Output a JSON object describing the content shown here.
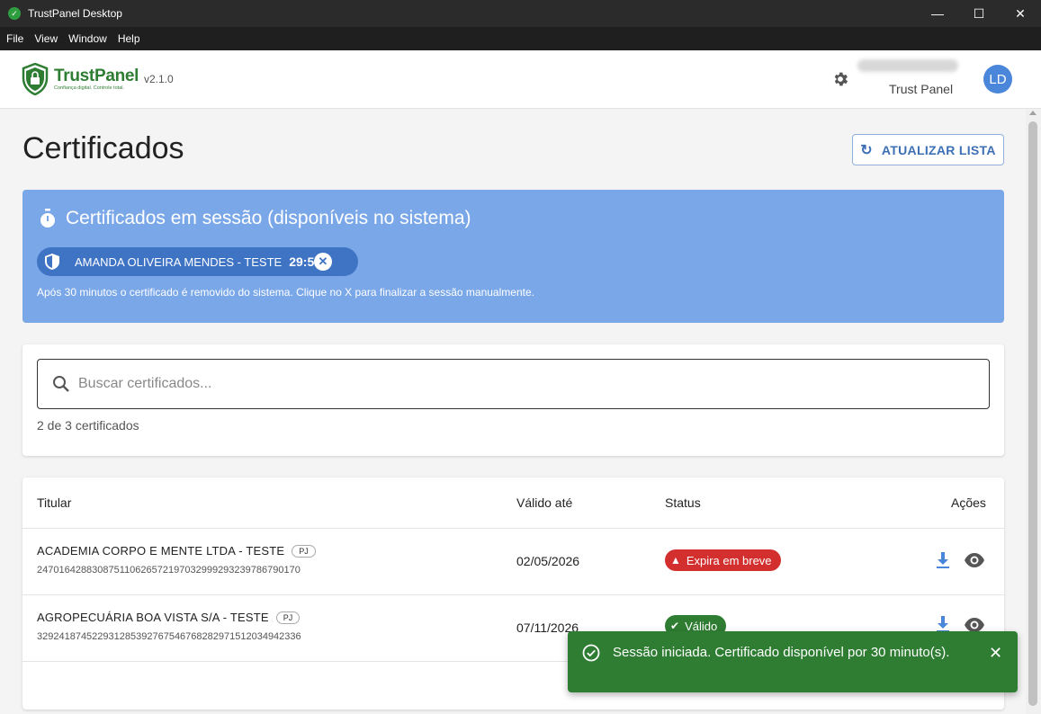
{
  "window": {
    "title": "TrustPanel Desktop",
    "controls": {
      "minimize": "—",
      "maximize": "☐",
      "close": "✕"
    }
  },
  "menu": [
    "File",
    "View",
    "Window",
    "Help"
  ],
  "header": {
    "logo_name": "TrustPanel",
    "logo_tagline": "Confiança digital. Controle total.",
    "version": "v2.1.0",
    "user_subtitle": "Trust Panel",
    "avatar_initials": "LD"
  },
  "page": {
    "title": "Certificados",
    "refresh_label": "ATUALIZAR LISTA"
  },
  "session": {
    "title": "Certificados em sessão (disponíveis no sistema)",
    "chip_name": "AMANDA OLIVEIRA MENDES - TESTE",
    "chip_time": "29:58",
    "note": "Após 30 minutos o certificado é removido do sistema. Clique no X para finalizar a sessão manualmente."
  },
  "search": {
    "placeholder": "Buscar certificados...",
    "count": "2 de 3 certificados"
  },
  "table": {
    "headers": {
      "holder": "Titular",
      "valid": "Válido até",
      "status": "Status",
      "actions": "Ações"
    },
    "rows": [
      {
        "name": "ACADEMIA CORPO E MENTE LTDA - TESTE",
        "type": "PJ",
        "hash": "247016428830875110626572197032999293239786790170",
        "valid_until": "02/05/2026",
        "status": "Expira em breve"
      },
      {
        "name": "AGROPECUÁRIA BOA VISTA S/A - TESTE",
        "type": "PJ",
        "hash": "329241874522931285392767546768282971512034942336",
        "valid_until": "07/11/2026",
        "status": "Válido"
      }
    ]
  },
  "toast": {
    "message": "Sessão iniciada. Certificado disponível por 30 minuto(s)."
  },
  "colors": {
    "brand_green": "#2e7d32",
    "session_blue": "#7aa7e8",
    "chip_blue": "#3f73c4",
    "warn_red": "#d32f2f",
    "accent_blue": "#4a86d9"
  }
}
